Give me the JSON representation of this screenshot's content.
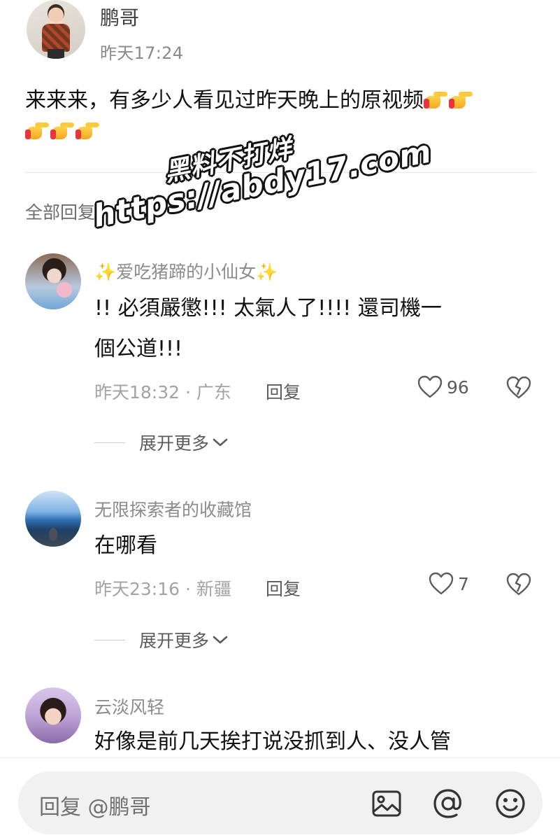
{
  "post": {
    "author": "鹏哥",
    "time": "昨天17:24",
    "text": "来来来，有多少人看见过昨天晚上的原视频",
    "emoji_count": 5,
    "emoji_name": "backhand-index-pointing-right"
  },
  "watermark": {
    "line1": "黑料不打烊",
    "line2": "https://abdy17.com"
  },
  "replies_header": "全部回复",
  "comments": [
    {
      "name": "✨爱吃猪蹄的小仙女✨",
      "text_line1": "!!  必須嚴懲!!!  太氣人了!!!!  還司機一",
      "text_line2": "個公道!!!",
      "meta": "昨天18:32 · 广东",
      "reply_label": "回复",
      "likes": "96",
      "expand_label": "展开更多"
    },
    {
      "name": "无限探索者的收藏馆",
      "text_line1": "在哪看",
      "meta": "昨天23:16 · 新疆",
      "reply_label": "回复",
      "likes": "7",
      "expand_label": "展开更多"
    },
    {
      "name": "云淡风轻",
      "text_line1": "好像是前几天挨打说没抓到人、没人管"
    }
  ],
  "input": {
    "placeholder": "回复 @鹏哥",
    "icons": [
      "image-icon",
      "at-icon",
      "emoji-icon"
    ]
  },
  "colors": {
    "text_primary": "#111111",
    "text_secondary": "#8c8c8c",
    "icon_gray": "#5c5c5c",
    "input_bg": "#f1f1f1"
  }
}
